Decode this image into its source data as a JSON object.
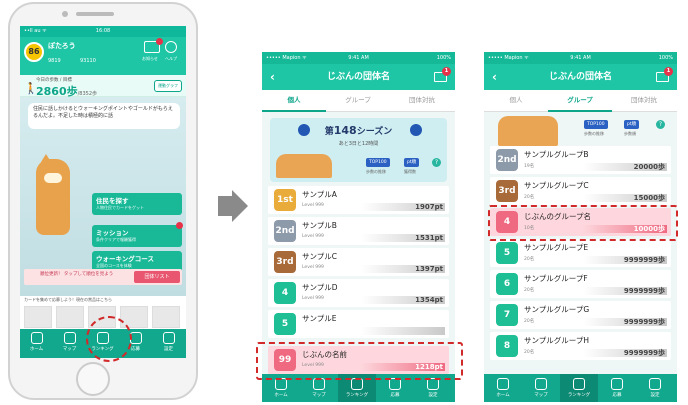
{
  "phone": {
    "status_left": "••ll au ᯤ",
    "status_time": "16:08",
    "level_label": "Level",
    "level": "86",
    "username": "ぽたろう",
    "coins": [
      "9819",
      "93110"
    ],
    "header_icons": [
      "お知らせ",
      "ヘルプ"
    ],
    "steps_label": "今日の歩数 / 目標",
    "steps_value": "2860歩",
    "steps_goal": "/8352歩",
    "graph_button": "運動グラフ",
    "bubble": "住民に話しかけるとウォーキングポイントやゴールドがもらえるんだよ。不足した時は積極的に話",
    "buttons": [
      {
        "title": "住民を探す",
        "sub": "人物住民でカードをゲット"
      },
      {
        "title": "ミッション",
        "sub": "条件クリアで報酬獲得"
      },
      {
        "title": "ウォーキングコース",
        "sub": "全国のコースを体験"
      }
    ],
    "alert_text": "順位更新！ タップして順位を見よう",
    "alert_button": "団体リスト",
    "ticker": "カードを集めて応募しよう！現在の賞品はこちら",
    "tabs": [
      "ホーム",
      "マップ",
      "ランキング",
      "応募",
      "設定"
    ]
  },
  "screen_common": {
    "carrier": "••••• Mapion ᯤ",
    "time": "9:41 AM",
    "battery": "100%",
    "title": "じぶんの団体名",
    "back": "‹",
    "mail_badge": "1",
    "tabs": [
      "個人",
      "グループ",
      "団体対抗"
    ],
    "bottom_tabs": [
      "ホーム",
      "マップ",
      "ランキング",
      "応募",
      "設定"
    ]
  },
  "screen_personal": {
    "active_tab": "個人",
    "season_prefix": "第",
    "season_num": "148",
    "season_suffix": "シーズン",
    "remaining": "あと3日と12時間",
    "top100": "TOP100",
    "top100_sub": "歩数の推移",
    "pt": "pt順",
    "pt_sub": "獲得数",
    "help": "?",
    "rows": [
      {
        "rank": "1st",
        "name": "サンプルA",
        "sub": "Level 999",
        "pts": "1907pt",
        "color": "#e9ab3a"
      },
      {
        "rank": "2nd",
        "name": "サンプルB",
        "sub": "Level 999",
        "pts": "1531pt",
        "color": "#8d9aaa"
      },
      {
        "rank": "3rd",
        "name": "サンプルC",
        "sub": "Level 999",
        "pts": "1397pt",
        "color": "#a86a38"
      },
      {
        "rank": "4",
        "name": "サンプルD",
        "sub": "Level 999",
        "pts": "1354pt",
        "color": "#1fbf95"
      },
      {
        "rank": "5",
        "name": "サンプルE",
        "sub": "",
        "pts": "",
        "color": "#1fbf95"
      }
    ],
    "self": {
      "rank": "99",
      "name": "じぶんの名前",
      "sub": "Level 999",
      "pts": "1218pt",
      "color": "#ef6a81"
    }
  },
  "screen_group": {
    "active_tab": "グループ",
    "top100": "TOP100",
    "top100_sub": "歩数の推移",
    "pt": "pt順",
    "pt_sub": "歩数順",
    "help": "?",
    "rows": [
      {
        "rank": "2nd",
        "name": "サンプルグループB",
        "sub": "19名",
        "pts": "20000歩",
        "color": "#8d9aaa"
      },
      {
        "rank": "3rd",
        "name": "サンプルグループC",
        "sub": "20名",
        "pts": "15000歩",
        "color": "#a86a38"
      },
      {
        "rank": "4",
        "name": "じぶんのグループ名",
        "sub": "10名",
        "pts": "10000歩",
        "color": "#ef6a81",
        "self": true
      },
      {
        "rank": "5",
        "name": "サンプルグループE",
        "sub": "20名",
        "pts": "9999999歩",
        "color": "#1fbf95"
      },
      {
        "rank": "6",
        "name": "サンプルグループF",
        "sub": "20名",
        "pts": "9999999歩",
        "color": "#1fbf95"
      },
      {
        "rank": "7",
        "name": "サンプルグループG",
        "sub": "20名",
        "pts": "9999999歩",
        "color": "#1fbf95"
      },
      {
        "rank": "8",
        "name": "サンプルグループH",
        "sub": "20名",
        "pts": "9999999歩",
        "color": "#1fbf95"
      }
    ]
  },
  "colors": {
    "teal": "#1ec6a5",
    "highlight": "#d22a2a",
    "pink": "#ef6a81"
  }
}
